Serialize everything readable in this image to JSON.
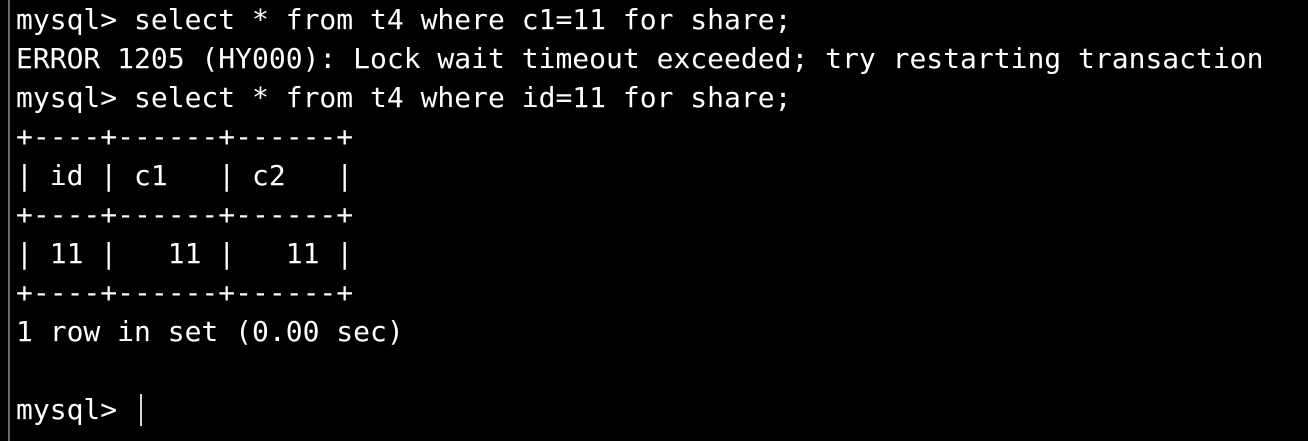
{
  "terminal": {
    "lines": [
      "mysql> select * from t4 where c1=11 for share;",
      "ERROR 1205 (HY000): Lock wait timeout exceeded; try restarting transaction",
      "mysql> select * from t4 where id=11 for share;",
      "+----+------+------+",
      "| id | c1   | c2   |",
      "+----+------+------+",
      "| 11 |   11 |   11 |",
      "+----+------+------+",
      "1 row in set (0.00 sec)",
      ""
    ],
    "prompt": "mysql> "
  }
}
